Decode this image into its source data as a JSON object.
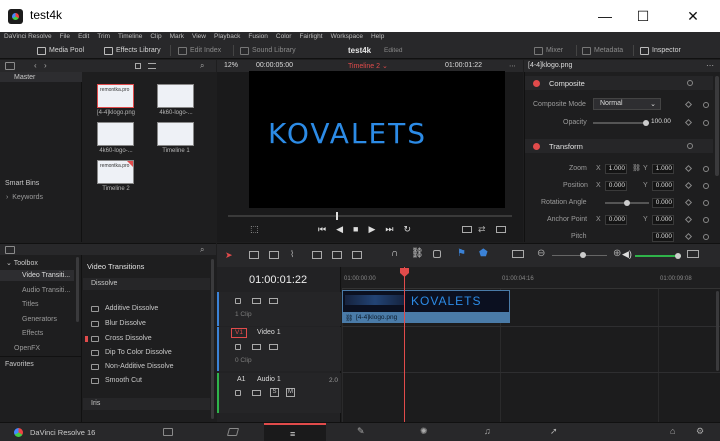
{
  "window": {
    "title": "test4k",
    "minimize_glyph": "—",
    "maximize_glyph": "☐",
    "close_glyph": "✕"
  },
  "menu": [
    "DaVinci Resolve",
    "File",
    "Edit",
    "Trim",
    "Timeline",
    "Clip",
    "Mark",
    "View",
    "Playback",
    "Fusion",
    "Color",
    "Fairlight",
    "Workspace",
    "Help"
  ],
  "toolbar": {
    "media_pool": "Media Pool",
    "effects_library": "Effects Library",
    "edit_index": "Edit Index",
    "sound_library": "Sound Library",
    "project_name": "test4k",
    "project_status": "Edited",
    "mixer": "Mixer",
    "metadata": "Metadata",
    "inspector": "Inspector"
  },
  "media_pool": {
    "bin_master": "Master",
    "smart_bins": "Smart Bins",
    "keywords": "Keywords",
    "clips": [
      {
        "name": "[4-4]klogo.png",
        "thumb_text": "remontka.pro"
      },
      {
        "name": "4k60-logo-...",
        "thumb_text": ""
      },
      {
        "name": "4k60-logo-...",
        "thumb_text": ""
      },
      {
        "name": "Timeline 1",
        "thumb_text": ""
      },
      {
        "name": "Timeline 2",
        "thumb_text": "remontka.pro"
      }
    ]
  },
  "viewer": {
    "zoom": "12%",
    "source_tc": "00:00:05:00",
    "timeline_name": "Timeline 2",
    "record_tc": "01:00:01:22",
    "logo_text": "KOVALETS"
  },
  "inspector": {
    "clip_title": "[4-4]klogo.png",
    "composite_header": "Composite",
    "composite_mode_label": "Composite Mode",
    "composite_mode_value": "Normal",
    "opacity_label": "Opacity",
    "opacity_value": "100.00",
    "transform_header": "Transform",
    "zoom_label": "Zoom",
    "zoom_x": "1.000",
    "zoom_y": "1.000",
    "position_label": "Position",
    "position_x": "0.000",
    "position_y": "0.000",
    "rotation_label": "Rotation Angle",
    "rotation_value": "0.000",
    "anchor_label": "Anchor Point",
    "anchor_x": "0.000",
    "anchor_y": "0.000",
    "pitch_label": "Pitch",
    "pitch_value": "0.000",
    "x": "X",
    "y": "Y"
  },
  "effects": {
    "toolbox": "Toolbox",
    "categories": [
      "Video Transiti...",
      "Audio Transiti...",
      "Titles",
      "Generators",
      "Effects"
    ],
    "openfx": "OpenFX",
    "favorites": "Favorites",
    "panel_title": "Video Transitions",
    "dissolve_header": "Dissolve",
    "dissolve_items": [
      "Additive Dissolve",
      "Blur Dissolve",
      "Cross Dissolve",
      "Dip To Color Dissolve",
      "Non-Additive Dissolve",
      "Smooth Cut"
    ],
    "iris_header": "Iris"
  },
  "timeline": {
    "timecode": "01:00:01:22",
    "ruler": [
      "01:00:00:00",
      "01:00:04:16",
      "01:00:09:08"
    ],
    "v1_label": "V1",
    "video1_name": "Video 1",
    "v2_clips": "1 Clip",
    "v1_clips": "0 Clip",
    "a1_label": "A1",
    "audio1_name": "Audio 1",
    "audio_ch": "2.0",
    "clip_name": "[4-4]klogo.png",
    "clip_logo": "KOVALETS",
    "solo": "S",
    "mute": "M"
  },
  "statusbar": {
    "app_version": "DaVinci Resolve 16"
  },
  "colors": {
    "accent_red": "#e14b4b",
    "logo_blue": "#2c8be6",
    "clip_blue": "#4a7ba8"
  }
}
